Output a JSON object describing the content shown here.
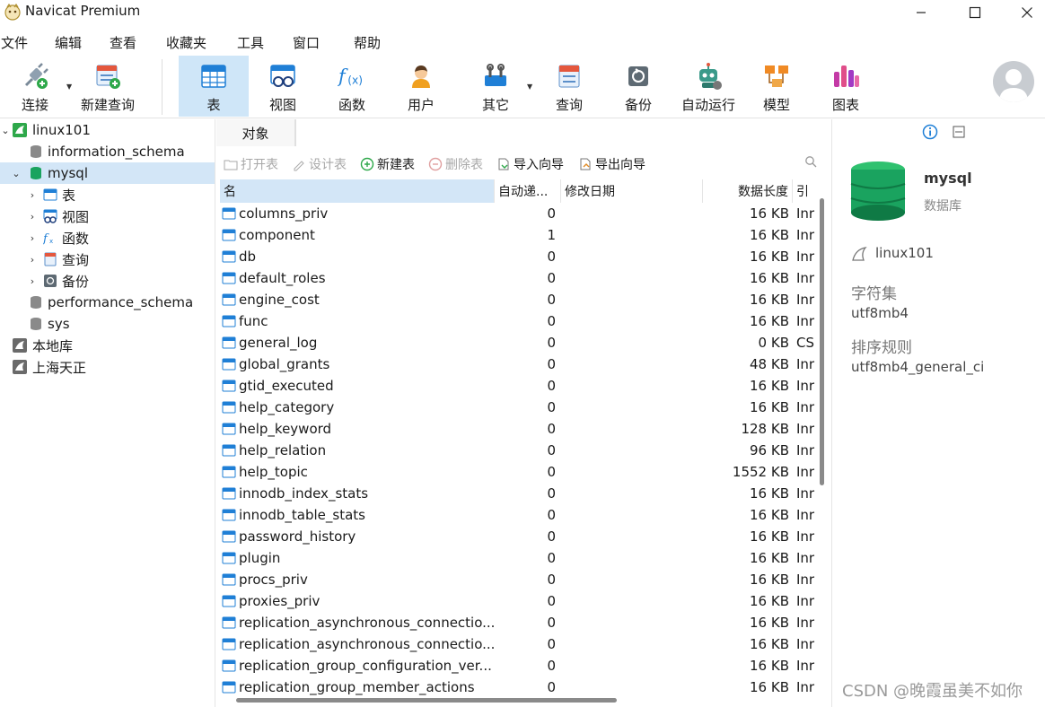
{
  "window": {
    "title": "Navicat Premium"
  },
  "menu": [
    "文件",
    "编辑",
    "查看",
    "收藏夹",
    "工具",
    "窗口",
    "帮助"
  ],
  "toolbar": {
    "connect": "连接",
    "new_query": "新建查询",
    "table": "表",
    "view": "视图",
    "function": "函数",
    "user": "用户",
    "other": "其它",
    "query": "查询",
    "backup": "备份",
    "automation": "自动运行",
    "model": "模型",
    "chart": "图表"
  },
  "tree": {
    "connection": "linux101",
    "db_information_schema": "information_schema",
    "db_mysql": "mysql",
    "node_table": "表",
    "node_view": "视图",
    "node_function": "函数",
    "node_query": "查询",
    "node_backup": "备份",
    "db_performance_schema": "performance_schema",
    "db_sys": "sys",
    "conn_local": "本地库",
    "conn_shanghai": "上海天正"
  },
  "tab": {
    "objects": "对象"
  },
  "object_toolbar": {
    "open_table": "打开表",
    "design_table": "设计表",
    "new_table": "新建表",
    "delete_table": "删除表",
    "import_wizard": "导入向导",
    "export_wizard": "导出向导"
  },
  "grid": {
    "columns": [
      "名",
      "自动递...",
      "修改日期",
      "数据长度",
      "引"
    ],
    "rows": [
      {
        "name": "columns_priv",
        "auto": "0",
        "date": "",
        "size": "16 KB",
        "engine": "Inr"
      },
      {
        "name": "component",
        "auto": "1",
        "date": "",
        "size": "16 KB",
        "engine": "Inr"
      },
      {
        "name": "db",
        "auto": "0",
        "date": "",
        "size": "16 KB",
        "engine": "Inr"
      },
      {
        "name": "default_roles",
        "auto": "0",
        "date": "",
        "size": "16 KB",
        "engine": "Inr"
      },
      {
        "name": "engine_cost",
        "auto": "0",
        "date": "",
        "size": "16 KB",
        "engine": "Inr"
      },
      {
        "name": "func",
        "auto": "0",
        "date": "",
        "size": "16 KB",
        "engine": "Inr"
      },
      {
        "name": "general_log",
        "auto": "0",
        "date": "",
        "size": "0 KB",
        "engine": "CS"
      },
      {
        "name": "global_grants",
        "auto": "0",
        "date": "",
        "size": "48 KB",
        "engine": "Inr"
      },
      {
        "name": "gtid_executed",
        "auto": "0",
        "date": "",
        "size": "16 KB",
        "engine": "Inr"
      },
      {
        "name": "help_category",
        "auto": "0",
        "date": "",
        "size": "16 KB",
        "engine": "Inr"
      },
      {
        "name": "help_keyword",
        "auto": "0",
        "date": "",
        "size": "128 KB",
        "engine": "Inr"
      },
      {
        "name": "help_relation",
        "auto": "0",
        "date": "",
        "size": "96 KB",
        "engine": "Inr"
      },
      {
        "name": "help_topic",
        "auto": "0",
        "date": "",
        "size": "1552 KB",
        "engine": "Inr"
      },
      {
        "name": "innodb_index_stats",
        "auto": "0",
        "date": "",
        "size": "16 KB",
        "engine": "Inr"
      },
      {
        "name": "innodb_table_stats",
        "auto": "0",
        "date": "",
        "size": "16 KB",
        "engine": "Inr"
      },
      {
        "name": "password_history",
        "auto": "0",
        "date": "",
        "size": "16 KB",
        "engine": "Inr"
      },
      {
        "name": "plugin",
        "auto": "0",
        "date": "",
        "size": "16 KB",
        "engine": "Inr"
      },
      {
        "name": "procs_priv",
        "auto": "0",
        "date": "",
        "size": "16 KB",
        "engine": "Inr"
      },
      {
        "name": "proxies_priv",
        "auto": "0",
        "date": "",
        "size": "16 KB",
        "engine": "Inr"
      },
      {
        "name": "replication_asynchronous_connectio...",
        "auto": "0",
        "date": "",
        "size": "16 KB",
        "engine": "Inr"
      },
      {
        "name": "replication_asynchronous_connectio...",
        "auto": "0",
        "date": "",
        "size": "16 KB",
        "engine": "Inr"
      },
      {
        "name": "replication_group_configuration_ver...",
        "auto": "0",
        "date": "",
        "size": "16 KB",
        "engine": "Inr"
      },
      {
        "name": "replication_group_member_actions",
        "auto": "0",
        "date": "",
        "size": "16 KB",
        "engine": "Inr"
      }
    ]
  },
  "info": {
    "db_name": "mysql",
    "db_type": "数据库",
    "connection": "linux101",
    "charset_label": "字符集",
    "charset_value": "utf8mb4",
    "collation_label": "排序规则",
    "collation_value": "utf8mb4_general_ci"
  },
  "watermark": "CSDN @晚霞虽美不如你",
  "colors": {
    "selection": "#d3e6f7",
    "active_tool": "#cfe6f8",
    "mysql_green": "#1aa35f",
    "table_blue": "#1f7fd6"
  }
}
